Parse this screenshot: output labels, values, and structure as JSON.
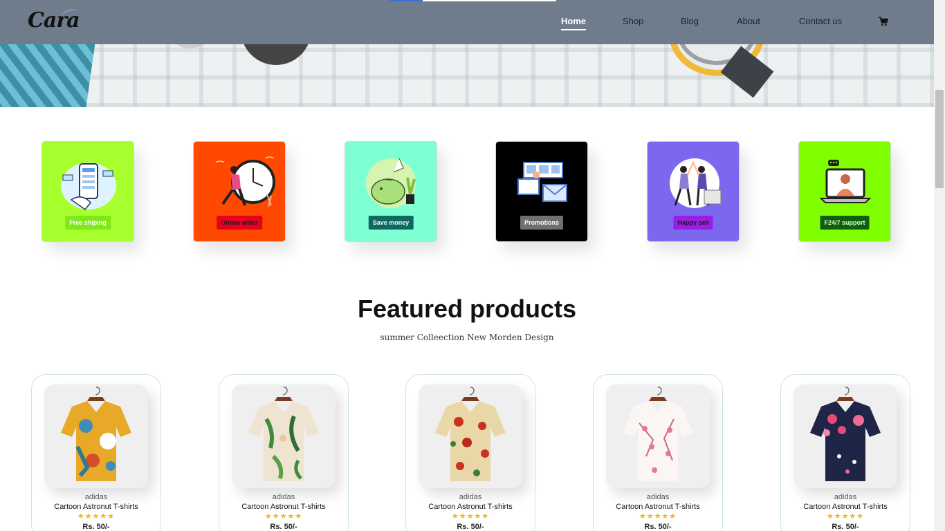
{
  "header": {
    "logo": "Cara",
    "nav": [
      {
        "label": "Home",
        "active": true
      },
      {
        "label": "Shop",
        "active": false
      },
      {
        "label": "Blog",
        "active": false
      },
      {
        "label": "About",
        "active": false
      },
      {
        "label": "Contact us",
        "active": false
      }
    ],
    "cart_icon": "cart-icon"
  },
  "features": [
    {
      "label": "Free shiping",
      "bg": "#a8ff2e",
      "label_bg": "#7fe81a",
      "label_color": "#ffffff",
      "icon": "phone-order-illustration"
    },
    {
      "label": "Online order",
      "bg": "#ff4800",
      "label_bg": "#e8001f",
      "label_color": "#1a1a1a",
      "icon": "clock-runner-illustration"
    },
    {
      "label": "Save money",
      "bg": "#7fffd4",
      "label_bg": "#10695f",
      "label_color": "#e9fff9",
      "icon": "piggy-bank-illustration"
    },
    {
      "label": "Promotions",
      "bg": "#000000",
      "label_bg": "#6f6f6f",
      "label_color": "#ffffff",
      "icon": "promotion-illustration"
    },
    {
      "label": "Happy sell",
      "bg": "#7b68ee",
      "label_bg": "#9b1ee8",
      "label_color": "#1a1a1a",
      "icon": "high-five-illustration"
    },
    {
      "label": "F24/7 support",
      "bg": "#7fff00",
      "label_bg": "#0e5f0e",
      "label_color": "#d9ffd0",
      "icon": "laptop-support-illustration"
    }
  ],
  "featured": {
    "title": "Featured products",
    "subtitle": "summer Colleection New Morden Design"
  },
  "products": [
    {
      "brand": "adidas",
      "name": "Cartoon Astronut T-shirts",
      "rating": 5,
      "stars": "★★★★★",
      "price": "Rs. 50/-",
      "pattern": "yellow-blue-floral"
    },
    {
      "brand": "adidas",
      "name": "Cartoon Astronut T-shirts",
      "rating": 5,
      "stars": "★★★★★",
      "price": "Rs. 50/-",
      "pattern": "green-leaf"
    },
    {
      "brand": "adidas",
      "name": "Cartoon Astronut T-shirts",
      "rating": 5,
      "stars": "★★★★★",
      "price": "Rs. 50/-",
      "pattern": "beige-red-floral"
    },
    {
      "brand": "adidas",
      "name": "Cartoon Astronut T-shirts",
      "rating": 5,
      "stars": "★★★★★",
      "price": "Rs. 50/-",
      "pattern": "white-pink-blossom"
    },
    {
      "brand": "adidas",
      "name": "Cartoon Astronut T-shirts",
      "rating": 5,
      "stars": "★★★★★",
      "price": "Rs. 50/-",
      "pattern": "navy-pink-floral"
    }
  ]
}
